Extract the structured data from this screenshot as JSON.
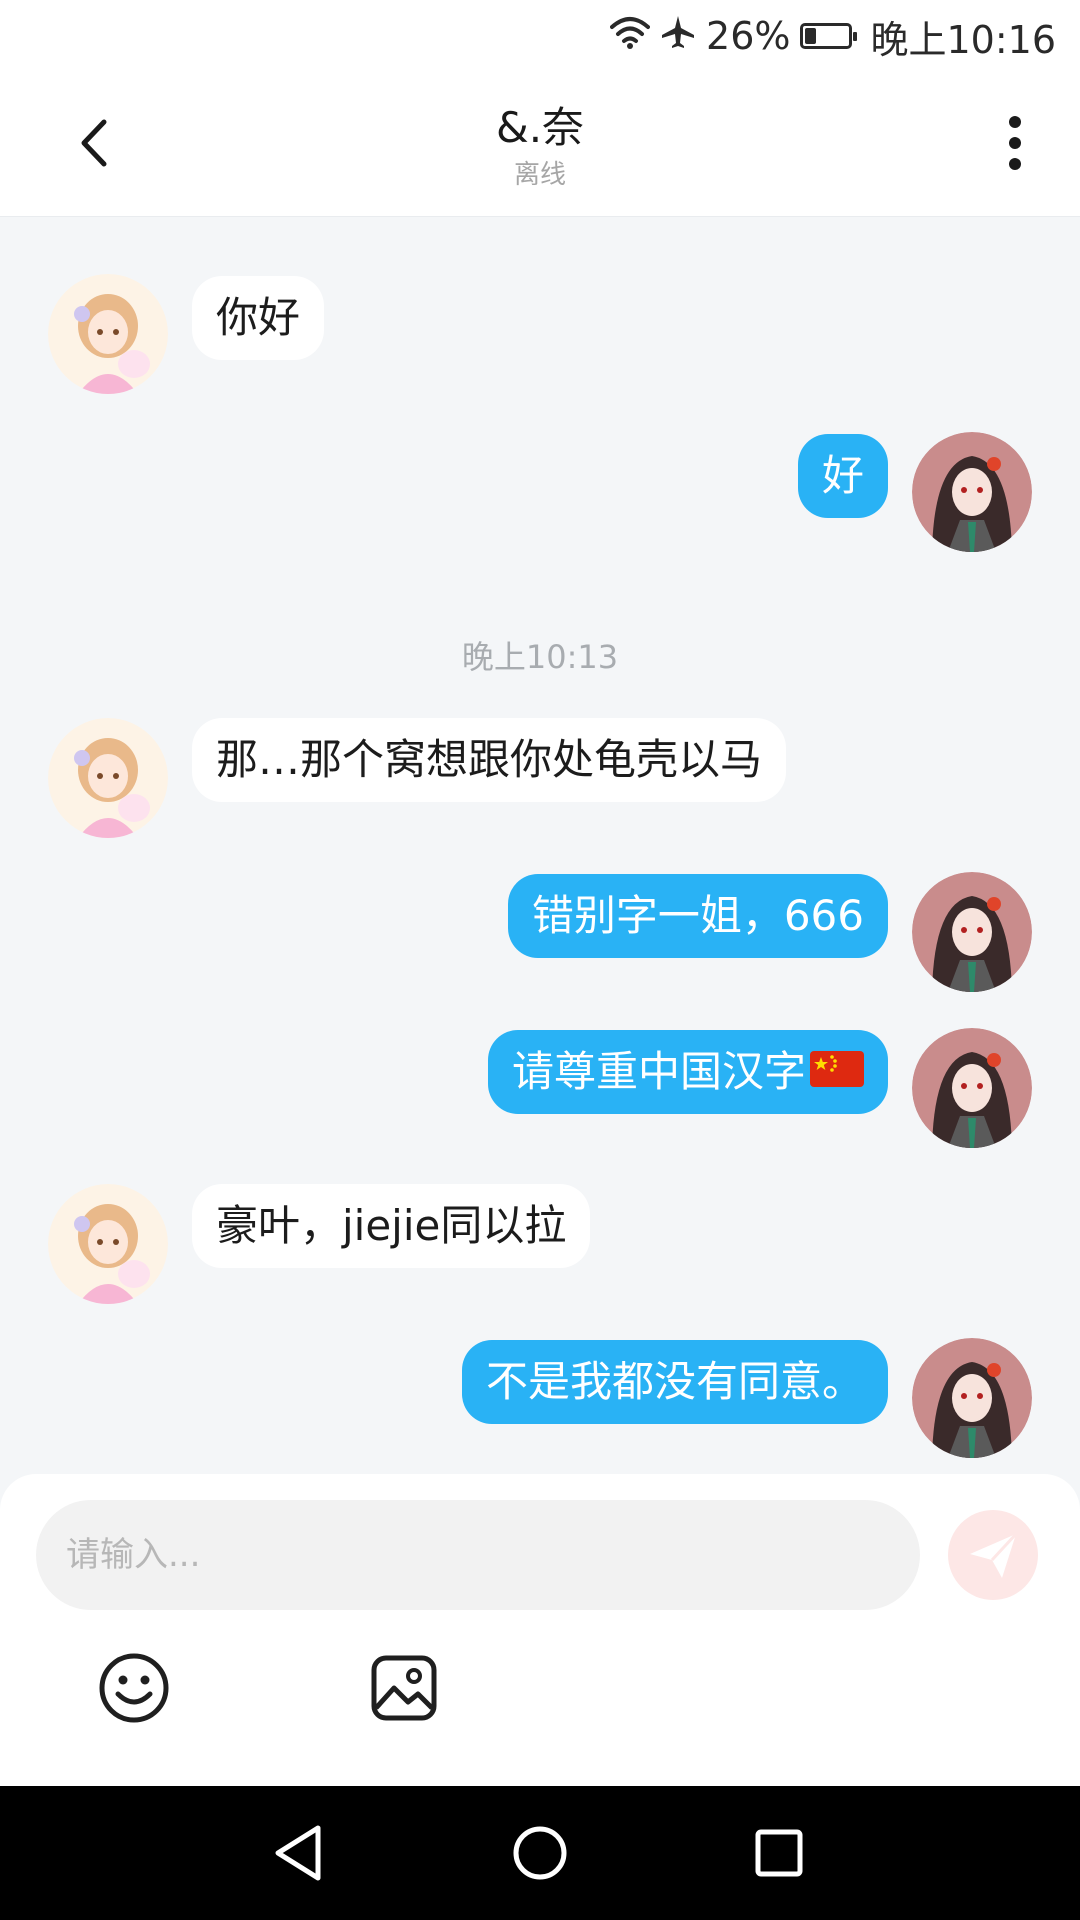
{
  "status_bar": {
    "battery": "26%",
    "time": "晚上10:16",
    "battery_level": 0.26
  },
  "header": {
    "title": "&.奈",
    "subtitle": "离线"
  },
  "messages": [
    {
      "side": "in",
      "text": "你好"
    },
    {
      "side": "out",
      "text": "好"
    },
    {
      "side": "in",
      "text": "那…那个窝想跟你处龟壳以马"
    },
    {
      "side": "out",
      "text": "错别字一姐，666"
    },
    {
      "side": "out",
      "text": "请尊重中国汉字",
      "emoji": "flag-china"
    },
    {
      "side": "in",
      "text": "豪叶，jiejie同以拉"
    },
    {
      "side": "out",
      "text": "不是我都没有同意。"
    }
  ],
  "time_separator": "晚上10:13",
  "input": {
    "placeholder": "请输入..."
  },
  "icons": {
    "back": "back-icon",
    "more": "more-vertical-icon",
    "send": "send-icon",
    "emoji": "emoji-icon",
    "image": "image-icon",
    "nav_back": "nav-back-icon",
    "nav_home": "nav-home-icon",
    "nav_recent": "nav-recent-icon"
  },
  "colors": {
    "accent": "#29b2f5",
    "send_button": "#fde7e6",
    "background": "#f4f6f8"
  }
}
